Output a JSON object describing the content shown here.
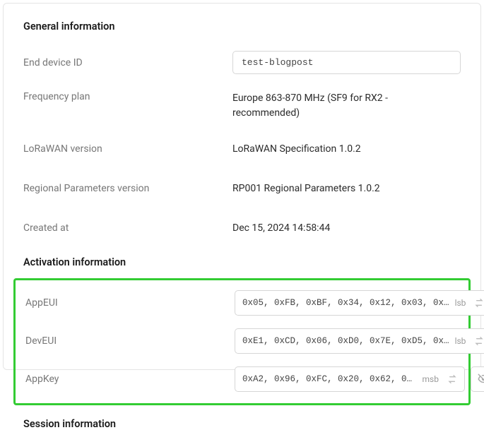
{
  "sections": {
    "general_title": "General information",
    "activation_title": "Activation information",
    "session_title": "Session information"
  },
  "general": {
    "device_id_label": "End device ID",
    "device_id_value": "test-blogpost",
    "freq_label": "Frequency plan",
    "freq_value": "Europe 863-870 MHz (SF9 for RX2 - recommended)",
    "lorawan_label": "LoRaWAN version",
    "lorawan_value": "LoRaWAN Specification 1.0.2",
    "regional_label": "Regional Parameters version",
    "regional_value": "RP001 Regional Parameters 1.0.2",
    "created_label": "Created at",
    "created_value": "Dec 15, 2024 14:58:44"
  },
  "activation": {
    "appeui_label": "AppEUI",
    "appeui_value": "0x05, 0xFB, 0xBF, 0x34, 0x12, 0x03, 0x…",
    "appeui_order": "lsb",
    "deveui_label": "DevEUI",
    "deveui_value": "0xE1, 0xCD, 0x06, 0xD0, 0x7E, 0xD5, 0x…",
    "deveui_order": "lsb",
    "appkey_label": "AppKey",
    "appkey_value": "0xA2, 0x96, 0xFC, 0x20, 0x62, 0xE…",
    "appkey_order": "msb"
  }
}
